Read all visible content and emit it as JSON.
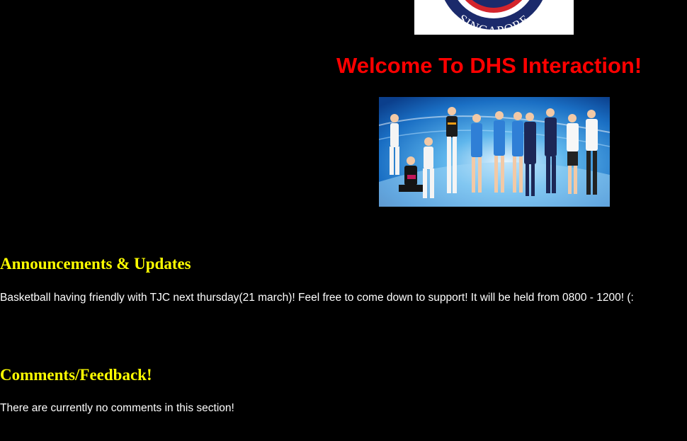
{
  "colors": {
    "background": "#000000",
    "title": "#ff0000",
    "heading": "#ffff00",
    "body_text": "#ffffff",
    "logo_ring": "#1b2a6b",
    "logo_accent": "#d4252c"
  },
  "logo": {
    "text": "SINGAPORE",
    "icon": "school-crest-icon"
  },
  "welcome": {
    "title": "Welcome To DHS Interaction!"
  },
  "photo": {
    "icon": "cca-group-photo"
  },
  "announcements": {
    "heading": "Announcements & Updates",
    "text": "Basketball having friendly with TJC next thursday(21 march)! Feel free to come down to support! It will be held from 0800 - 1200! (:"
  },
  "comments": {
    "heading": "Comments/Feedback!",
    "text": "There are currently no comments in this section!"
  }
}
